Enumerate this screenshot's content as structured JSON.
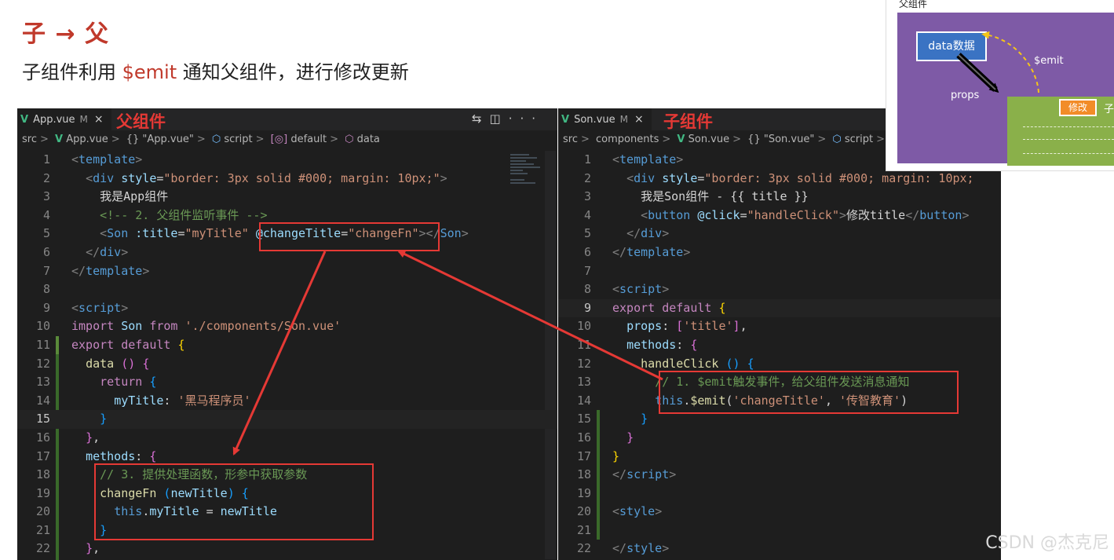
{
  "slide": {
    "heading": "子 → 父",
    "subline_pre": "子组件利用 ",
    "subline_accent": "$emit",
    "subline_post": " 通知父组件，进行修改更新"
  },
  "left_editor": {
    "tab_label": "App.vue",
    "tab_modified": "M",
    "tab_close": "×",
    "annotation": "父组件",
    "breadcrumb": [
      "src",
      "App.vue",
      "{} \"App.vue\"",
      "script",
      "default",
      "data"
    ]
  },
  "right_editor": {
    "tab_label": "Son.vue",
    "tab_modified": "M",
    "tab_close": "×",
    "annotation": "子组件",
    "breadcrumb": [
      "src",
      "components",
      "Son.vue",
      "{} \"Son.vue\"",
      "script"
    ]
  },
  "diagram": {
    "title": "父组件",
    "data_label": "data数据",
    "emit_label": "$emit",
    "props_label": "props",
    "modify_label": "修改",
    "child_label": "子组"
  },
  "watermark": "CSDN @杰克尼",
  "colors": {
    "accent_red": "#c0392b",
    "annotation_red": "#e53935",
    "vue_green": "#41b883",
    "parent_purple": "#7e5aa6",
    "child_green": "#8ab04a",
    "data_blue": "#3a73c3",
    "modify_orange": "#f28c28"
  }
}
